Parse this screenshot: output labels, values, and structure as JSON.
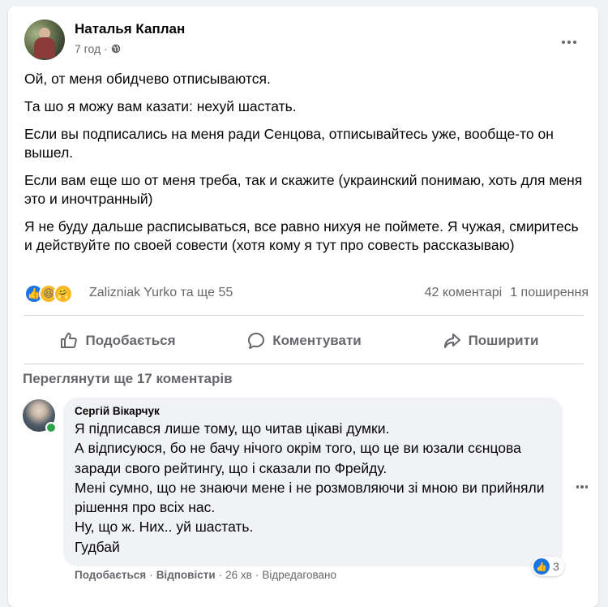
{
  "post": {
    "author": "Наталья Каплан",
    "time": "7 год",
    "paragraphs": [
      "Ой, от меня обидчево отписываются.",
      "Та шо я можу вам казати: нехуй шастать.",
      "Если вы подписались на меня ради Сенцова, отписывайтесь уже, вообще-то он вышел.",
      "Если вам еще шо от меня треба, так и скажите (украинский понимаю, хоть для меня это и иночтранный)",
      "Я не буду дальше расписываться, все равно нихуя не поймете. Я чужая, смиритесь и действуйте по своей совести (хотя кому я тут про совесть рассказываю)"
    ],
    "reactions_text": "Zalizniak Yurko та ще 55",
    "comments_count": "42 коментарі",
    "shares_count": "1 поширення"
  },
  "actions": {
    "like": "Подобається",
    "comment": "Коментувати",
    "share": "Поширити"
  },
  "view_more": "Переглянути ще 17 коментарів",
  "comment": {
    "author": "Сергій Вікарчук",
    "lines": [
      "Я підписався лише тому, що читав цікаві думки.",
      "А відписуюся, бо не бачу нічого окрім того, що це ви юзали сєнцова заради свого рейтингу, що і сказали по Фрейду.",
      "Мені сумно, що не знаючи мене і не розмовляючи зі мною ви прийняли рішення про всіх нас.",
      "Ну, що ж. Них.. уй шастать.",
      "Гудбай"
    ],
    "like_label": "Подобається",
    "reply_label": "Відповісти",
    "time": "26 хв",
    "edited": "Відредаговано",
    "reaction_count": "3"
  },
  "colors": {
    "accent": "#1b74e4",
    "secondary_text": "#65676b",
    "online": "#31a24c"
  }
}
